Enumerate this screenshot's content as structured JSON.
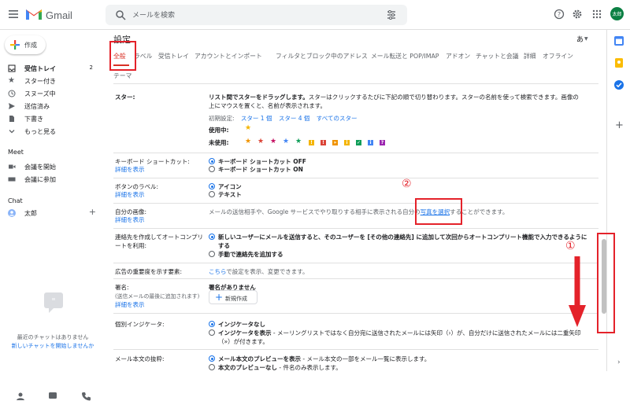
{
  "app": {
    "name": "Gmail",
    "avatar_label": "太郎"
  },
  "search": {
    "placeholder": "メールを検索"
  },
  "compose_label": "作成",
  "nav": [
    {
      "label": "受信トレイ",
      "count": "2",
      "icon": "inbox-icon"
    },
    {
      "label": "スター付き",
      "icon": "star-icon"
    },
    {
      "label": "スヌーズ中",
      "icon": "clock-icon"
    },
    {
      "label": "送信済み",
      "icon": "send-icon"
    },
    {
      "label": "下書き",
      "icon": "draft-icon"
    },
    {
      "label": "もっと見る",
      "icon": "chevron-down-icon"
    }
  ],
  "meet": {
    "title": "Meet",
    "items": [
      "会議を開始",
      "会議に参加"
    ]
  },
  "chat": {
    "title": "Chat",
    "user": "太郎",
    "none": "最近のチャットはありません",
    "new": "新しいチャットを開始しませんか"
  },
  "settings": {
    "title": "設定",
    "lang_selector": "あ",
    "tabs": [
      "全般",
      "ラベル",
      "受信トレイ",
      "アカウントとインポート",
      "フィルタとブロック中のアドレス",
      "メール転送と POP/IMAP",
      "アドオン",
      "チャットと会議",
      "詳細",
      "オフライン"
    ],
    "tab_row2": "テーマ",
    "stars": {
      "label": "スター:",
      "desc1": "リスト間でスターをドラッグします。",
      "desc1b": "スターはクリックするたびに下記の順で切り替わります。スターの名前を使って検索できます。画像の",
      "desc2": "上にマウスを置くと、名前が表示されます。",
      "preset_label": "初期設定:",
      "preset1": "スター 1 個",
      "preset4": "スター 4 個",
      "preset_all": "すべてのスター",
      "in_use": "使用中:",
      "unused": "未使用:"
    },
    "shortcuts": {
      "label": "キーボード ショートカット:",
      "detail": "詳細を表示",
      "off": "キーボード ショートカット OFF",
      "on": "キーボード ショートカット ON"
    },
    "button_labels": {
      "label": "ボタンのラベル:",
      "detail": "詳細を表示",
      "icon": "アイコン",
      "text": "テキスト"
    },
    "my_picture": {
      "label": "自分の画像:",
      "detail": "詳細を表示",
      "desc_pre": "メールの送信相手や、Google サービスでやり取りする相手に表示される自分の",
      "link": "写真を選択",
      "desc_post": "することができます。"
    },
    "autocomplete": {
      "label": "連絡先を作成してオートコンプリートを利用:",
      "opt1": "新しいユーザーにメールを送信すると、そのユーザーを [その他の連絡先] に追加して次回からオートコンプリート機能で入力できるように",
      "opt1b": "する",
      "opt2": "手動で連絡先を追加する"
    },
    "importance": {
      "label": "広告の重要度を示す要素:",
      "link": "こちら",
      "rest": "で設定を表示、変更できます。"
    },
    "signature": {
      "label": "署名:",
      "sub": "(送信メールの最後に追加されます)",
      "detail": "詳細を表示",
      "none": "署名がありません",
      "new_button": "新規作成"
    },
    "personal": {
      "label": "個別インジケータ:",
      "opt1": "インジケータなし",
      "opt2": "インジケータを表示",
      "opt2_rest": " - メーリングリストではなく自分宛に送信されたメールには矢印（›）が、自分だけに送信されたメールには二重矢印",
      "opt2b": "（»）が付きます。"
    },
    "snippets": {
      "label": "メール本文の抜粋:",
      "opt1": "メール本文のプレビューを表示",
      "opt1_rest": " - メール本文の一部をメール一覧に表示します。",
      "opt2": "本文のプレビューなし",
      "opt2_rest": " - 件名のみ表示します。"
    }
  },
  "annotations": {
    "one": "①",
    "two": "②"
  },
  "colors": {
    "annotation": "#e4222a",
    "link": "#1a73e8",
    "accent": "#d93025"
  }
}
